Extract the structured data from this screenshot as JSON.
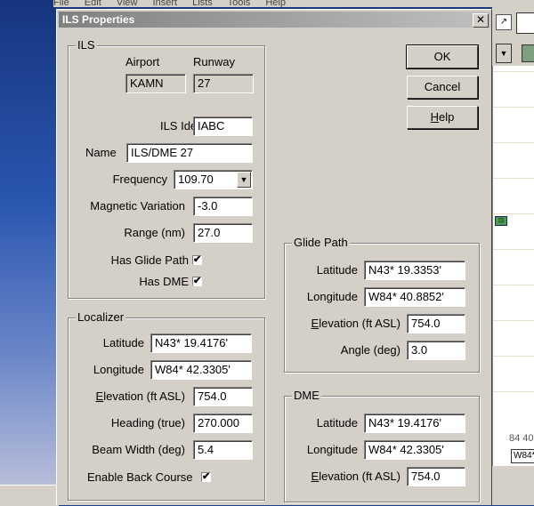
{
  "background_menu": [
    "File",
    "Edit",
    "View",
    "Insert",
    "Lists",
    "Tools",
    "Help"
  ],
  "right_pane": {
    "coord_text": "84 40",
    "coord_field": "W84*"
  },
  "dialog": {
    "title": "ILS Properties",
    "close_glyph": "✕",
    "buttons": {
      "ok": "OK",
      "cancel": "Cancel",
      "help": "Help"
    },
    "ils": {
      "group_title": "ILS",
      "airport_label": "Airport",
      "runway_label": "Runway",
      "airport_value": "KAMN",
      "runway_value": "27",
      "ident_label": "ILS Ident",
      "ident_value": "IABC",
      "name_label": "Name",
      "name_value": "ILS/DME 27",
      "frequency_label": "Frequency",
      "frequency_value": "109.70",
      "magvar_label": "Magnetic Variation",
      "magvar_value": "-3.0",
      "range_label": "Range (nm)",
      "range_value": "27.0",
      "has_glide_label": "Has Glide Path",
      "has_glide_checked": true,
      "has_dme_label": "Has DME",
      "has_dme_checked": true
    },
    "localizer": {
      "group_title": "Localizer",
      "latitude_label": "Latitude",
      "latitude_value": "N43* 19.4176'",
      "longitude_label": "Longitude",
      "longitude_value": "W84* 42.3305'",
      "elevation_label_u": "E",
      "elevation_label_rest": "levation (ft ASL)",
      "elevation_value": "754.0",
      "heading_label": "Heading (true)",
      "heading_value": "270.000",
      "beam_label": "Beam Width (deg)",
      "beam_value": "5.4",
      "back_course_label": "Enable Back Course",
      "back_course_checked": true
    },
    "glide_path": {
      "group_title": "Glide Path",
      "latitude_label": "Latitude",
      "latitude_value": "N43* 19.3353'",
      "longitude_label": "Longitude",
      "longitude_value": "W84* 40.8852'",
      "elevation_label_u": "E",
      "elevation_label_rest": "levation (ft ASL)",
      "elevation_value": "754.0",
      "angle_label": "Angle (deg)",
      "angle_value": "3.0"
    },
    "dme": {
      "group_title": "DME",
      "latitude_label": "Latitude",
      "latitude_value": "N43* 19.4176'",
      "longitude_label": "Longitude",
      "longitude_value": "W84* 42.3305'",
      "elevation_label_u": "E",
      "elevation_label_rest": "levation (ft ASL)",
      "elevation_value": "754.0"
    }
  },
  "checkmark": "✔",
  "colors": {
    "titlebar_start": "#808080",
    "titlebar_end": "#c0c0c0",
    "face": "#d4d0c8"
  }
}
